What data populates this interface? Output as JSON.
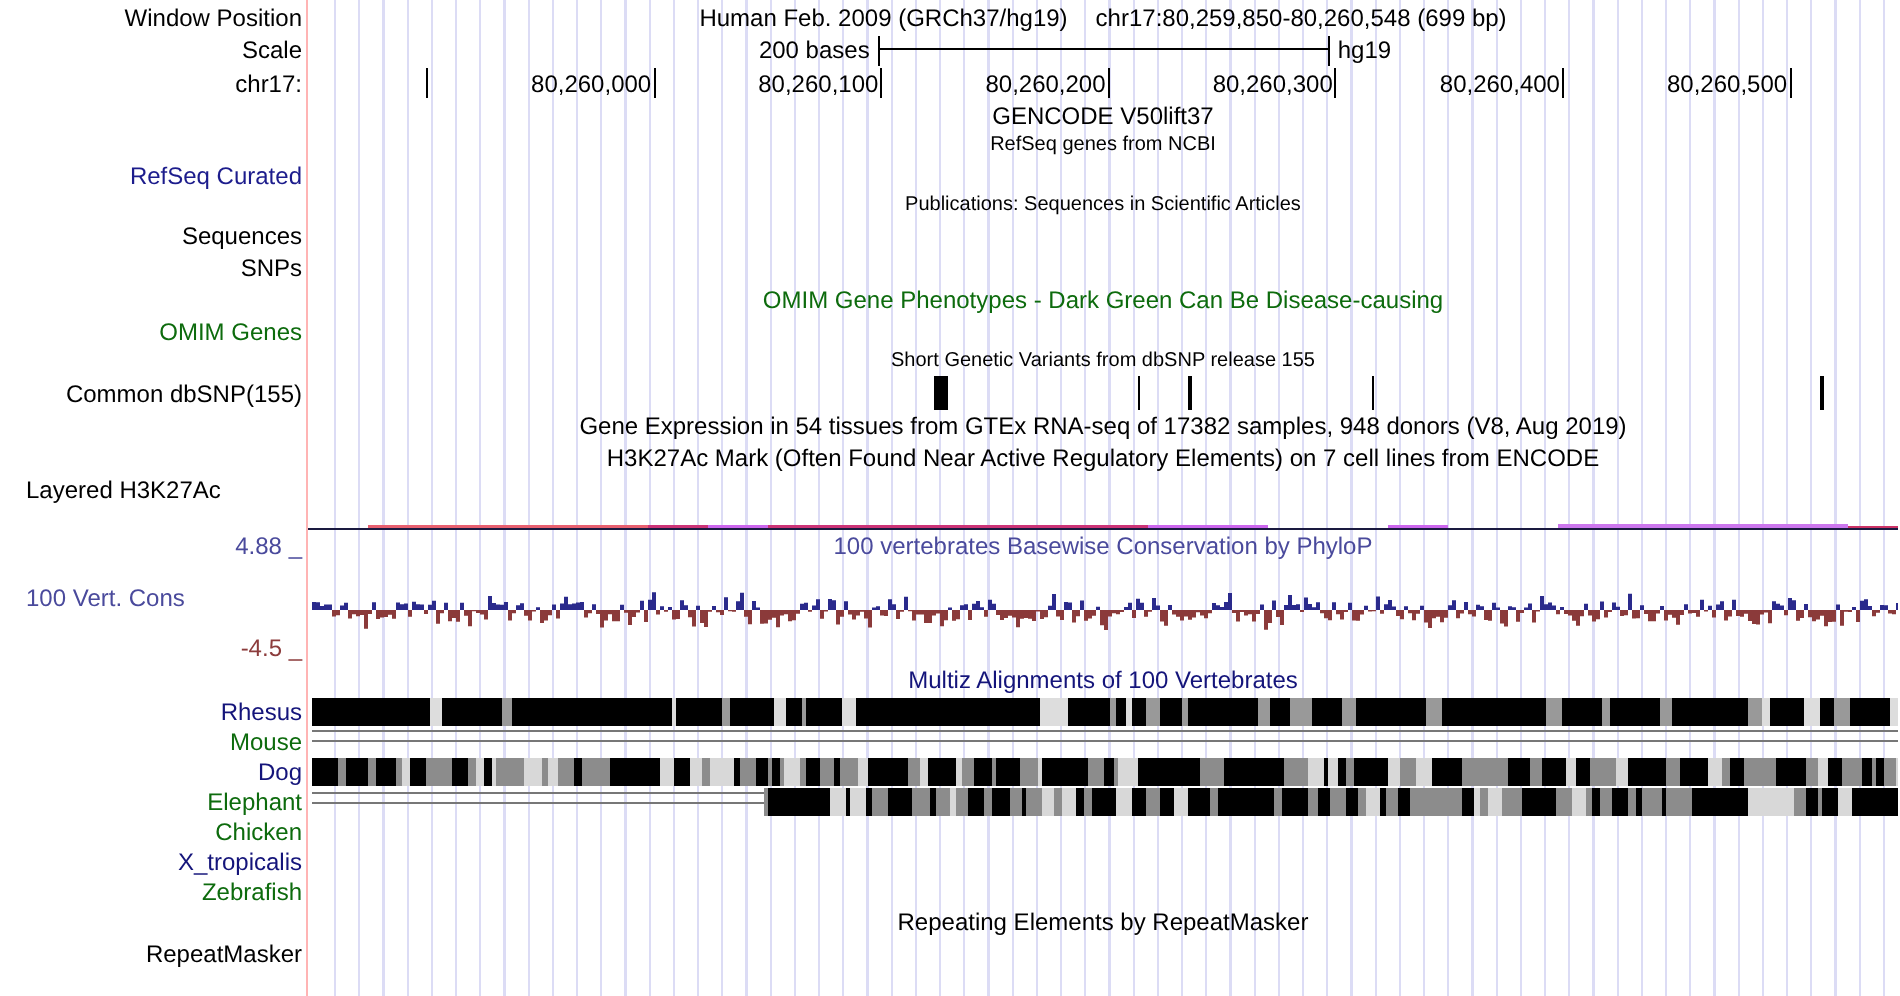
{
  "header": {
    "label": "Window Position",
    "assembly": "Human Feb. 2009 (GRCh37/hg19)",
    "position": "chr17:80,259,850-80,260,548 (699 bp)"
  },
  "scale": {
    "label": "Scale",
    "length": "200 bases",
    "assembly": "hg19"
  },
  "ruler": {
    "label": "chr17:",
    "ticks": [
      "80,260,000",
      "80,260,100",
      "80,260,200",
      "80,260,300",
      "80,260,400",
      "80,260,500"
    ]
  },
  "tracks": [
    {
      "kind": "text",
      "title": {
        "text": "GENCODE V50lift37",
        "color": "#000000"
      }
    },
    {
      "kind": "small_text",
      "title": {
        "text": "RefSeq genes from NCBI",
        "color": "#000000"
      }
    },
    {
      "kind": "none",
      "label": {
        "text": "RefSeq Curated",
        "color": "#1c1c8c"
      }
    },
    {
      "kind": "small_text",
      "title": {
        "text": "Publications: Sequences in Scientific Articles",
        "color": "#000000"
      }
    },
    {
      "kind": "none",
      "label": {
        "text": "Sequences",
        "color": "#000000"
      }
    },
    {
      "kind": "none",
      "label": {
        "text": "SNPs",
        "color": "#000000"
      }
    },
    {
      "kind": "text",
      "title": {
        "text": "OMIM Gene Phenotypes - Dark Green Can Be Disease-causing",
        "color": "#0d6b0d"
      }
    },
    {
      "kind": "none",
      "label": {
        "text": "OMIM Genes",
        "color": "#0d6b0d"
      }
    },
    {
      "kind": "small_text",
      "title": {
        "text": "Short Genetic Variants from dbSNP release 155",
        "color": "#000000"
      }
    },
    {
      "kind": "snp",
      "label": {
        "text": "Common dbSNP(155)",
        "color": "#000000"
      }
    },
    {
      "kind": "text",
      "title": {
        "text": "Gene Expression in 54 tissues from GTEx RNA-seq of 17382 samples, 948 donors (V8, Aug 2019)",
        "color": "#000000"
      }
    },
    {
      "kind": "text",
      "title": {
        "text": "H3K27Ac Mark (Often Found Near Active Regulatory Elements) on 7 cell lines from ENCODE",
        "color": "#000000"
      }
    },
    {
      "kind": "layered",
      "label": {
        "text": "Layered H3K27Ac",
        "color": "#000000"
      }
    },
    {
      "kind": "text",
      "label": {
        "text": "4.88 _",
        "color": "#4a4a9c"
      },
      "title": {
        "text": "100 vertebrates Basewise Conservation by PhyloP",
        "color": "#4a4a9c"
      }
    },
    {
      "kind": "wiggle",
      "label": {
        "text": "100 Vert. Cons",
        "color": "#4a4a9c"
      }
    },
    {
      "kind": "none",
      "label": {
        "text": "-4.5 _",
        "color": "#8c3c3c"
      }
    },
    {
      "kind": "text",
      "title": {
        "text": "Multiz Alignments of 100 Vertebrates",
        "color": "#14147a"
      }
    },
    {
      "kind": "solid",
      "label": {
        "text": "Rhesus",
        "color": "#14147a"
      }
    },
    {
      "kind": "double_line",
      "label": {
        "text": "Mouse",
        "color": "#0d6b0d"
      }
    },
    {
      "kind": "barcode",
      "label": {
        "text": "Dog",
        "color": "#14147a"
      }
    },
    {
      "kind": "line_then_barcode",
      "label": {
        "text": "Elephant",
        "color": "#0d6b0d"
      }
    },
    {
      "kind": "species",
      "label": {
        "text": "Chicken",
        "color": "#0d6b0d"
      }
    },
    {
      "kind": "species",
      "label": {
        "text": "X_tropicalis",
        "color": "#14147a"
      }
    },
    {
      "kind": "species",
      "label": {
        "text": "Zebrafish",
        "color": "#0d6b0d"
      }
    },
    {
      "kind": "text",
      "title": {
        "text": "Repeating Elements by RepeatMasker",
        "color": "#000000"
      }
    },
    {
      "kind": "none",
      "label": {
        "text": "RepeatMasker",
        "color": "#000000"
      }
    }
  ]
}
